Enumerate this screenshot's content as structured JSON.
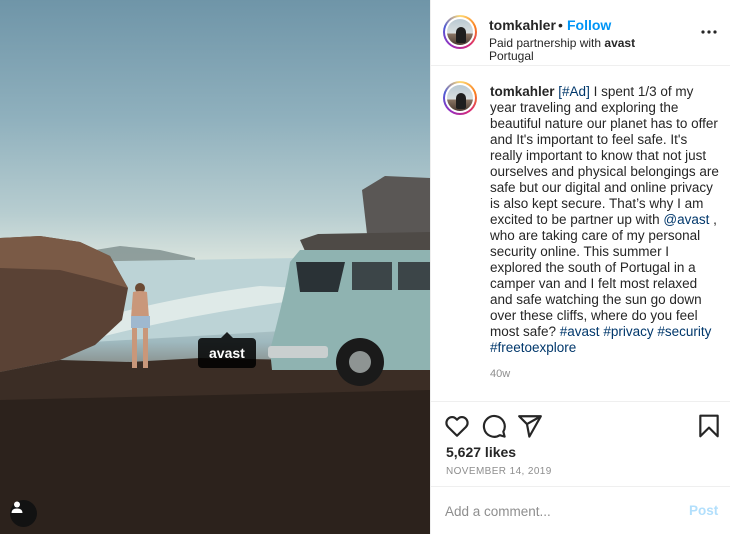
{
  "post": {
    "username": "tomkahler",
    "follow_label": "Follow",
    "separator": "•",
    "partnership_prefix": "Paid partnership with",
    "partner": "avast",
    "location": "Portugal",
    "photo_tag": "avast"
  },
  "caption": {
    "username": "tomkahler",
    "ad_tag": "[#Ad]",
    "text_1": " I spent 1/3 of my year traveling and exploring the beautiful nature our planet has to offer and It's important to feel safe. It's really important to know that not just ourselves and physical belongings are safe but our digital and online privacy is also kept secure. That’s why I am excited to be partner up with ",
    "mention": "@avast",
    "text_2": " , who are taking care of my personal security online. This summer I explored the south of Portugal in a camper van and I felt most relaxed and safe watching the sun go down over these cliffs, where do you feel most safe? ",
    "hashtags": [
      "#avast",
      "#privacy",
      "#security",
      "#freetoexplore"
    ],
    "time_ago": "40w"
  },
  "actions": {
    "icons": [
      "heart-icon",
      "comment-icon",
      "share-icon",
      "bookmark-icon"
    ],
    "likes": "5,627 likes",
    "date": "NOVEMBER 14, 2019"
  },
  "comment": {
    "placeholder": "Add a comment...",
    "post_label": "Post"
  },
  "colors": {
    "link_blue": "#0095f6",
    "hashtag_blue": "#00376b",
    "post_disabled": "#b2dffc",
    "muted": "#8e8e8e",
    "text": "#262626",
    "divider": "#efefef"
  }
}
